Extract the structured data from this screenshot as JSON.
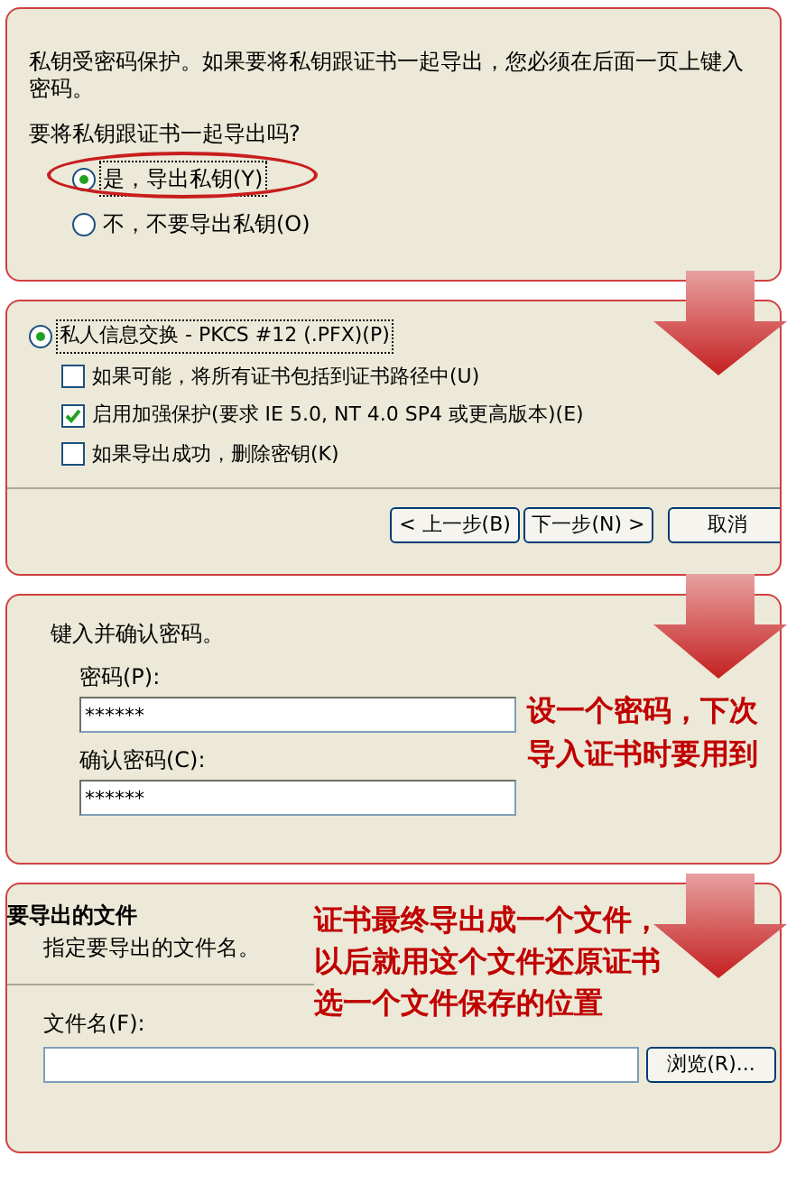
{
  "export_key_panel": {
    "description": "私钥受密码保护。如果要将私钥跟证书一起导出，您必须在后面一页上键入密码。",
    "question": "要将私钥跟证书一起导出吗?",
    "options": [
      {
        "label": "是，导出私钥(Y)",
        "selected": true,
        "circled": true
      },
      {
        "label": "不，不要导出私钥(O)",
        "selected": false,
        "circled": false
      }
    ]
  },
  "format_panel": {
    "format_option": {
      "label": "私人信息交换 - PKCS #12 (.PFX)(P)",
      "selected": true
    },
    "checkboxes": [
      {
        "label": "如果可能，将所有证书包括到证书路径中(U)",
        "checked": false
      },
      {
        "label": "启用加强保护(要求 IE 5.0, NT 4.0 SP4 或更高版本)(E)",
        "checked": true
      },
      {
        "label": "如果导出成功，删除密钥(K)",
        "checked": false
      }
    ],
    "buttons": [
      {
        "label": "< 上一步(B)",
        "kind": "back"
      },
      {
        "label": "下一步(N) >",
        "kind": "next"
      },
      {
        "label": "取消",
        "kind": "cancel"
      }
    ]
  },
  "password_panel": {
    "instruction": "键入并确认密码。",
    "fields": [
      {
        "label": "密码(P):",
        "value": "******"
      },
      {
        "label": "确认密码(C):",
        "value": "******"
      }
    ],
    "annotation": [
      "设一个密码，下次",
      "导入证书时要用到"
    ]
  },
  "file_panel": {
    "heading": "要导出的文件",
    "subheading": "指定要导出的文件名。",
    "file_label": "文件名(F):",
    "browse_button": "浏览(R)...",
    "annotation": [
      "证书最终导出成一个文件，",
      "以后就用这个文件还原证书",
      "选一个文件保存的位置"
    ]
  }
}
